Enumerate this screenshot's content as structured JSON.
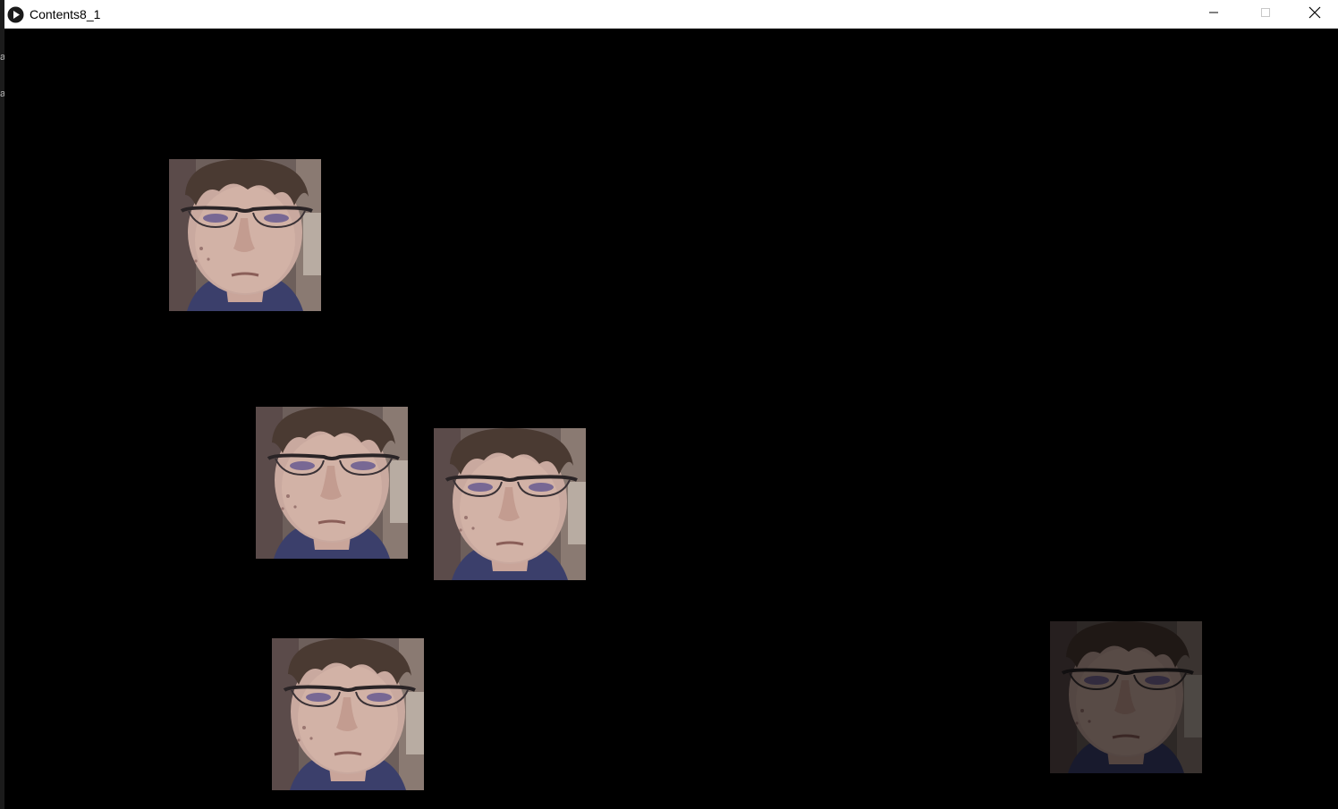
{
  "window": {
    "title": "Contents8_1",
    "app_icon": "play-circle-icon",
    "controls": {
      "minimize_icon": "minimize-icon",
      "maximize_icon": "maximize-icon",
      "close_icon": "close-icon"
    }
  },
  "desktop": {
    "fragments": [
      "a",
      "a"
    ]
  },
  "canvas": {
    "background": "#000000",
    "face_tiles": [
      {
        "name": "face-tile-1",
        "brightness": "full"
      },
      {
        "name": "face-tile-2",
        "brightness": "full"
      },
      {
        "name": "face-tile-3",
        "brightness": "full"
      },
      {
        "name": "face-tile-4",
        "brightness": "full"
      },
      {
        "name": "face-tile-5",
        "brightness": "dim"
      }
    ]
  }
}
